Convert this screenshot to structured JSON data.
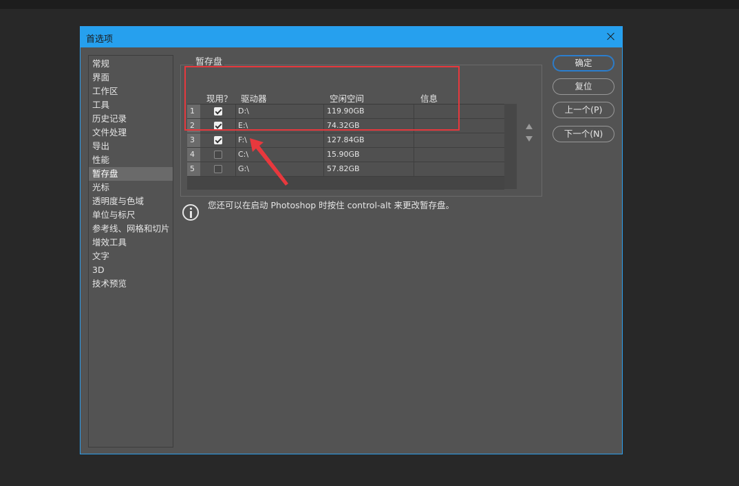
{
  "window": {
    "title": "首选项"
  },
  "sidebar": {
    "items": [
      {
        "label": "常规"
      },
      {
        "label": "界面"
      },
      {
        "label": "工作区"
      },
      {
        "label": "工具"
      },
      {
        "label": "历史记录"
      },
      {
        "label": "文件处理"
      },
      {
        "label": "导出"
      },
      {
        "label": "性能"
      },
      {
        "label": "暂存盘",
        "active": true
      },
      {
        "label": "光标"
      },
      {
        "label": "透明度与色域"
      },
      {
        "label": "单位与标尺"
      },
      {
        "label": "参考线、网格和切片"
      },
      {
        "label": "增效工具"
      },
      {
        "label": "文字"
      },
      {
        "label": "3D"
      },
      {
        "label": "技术预览"
      }
    ]
  },
  "scratch": {
    "group_label": "暂存盘",
    "columns": {
      "active": "现用？",
      "drive": "驱动器",
      "space": "空闲空间",
      "info": "信息"
    },
    "rows": [
      {
        "index": "1",
        "checked": true,
        "drive": "D:\\",
        "space": "119.90GB"
      },
      {
        "index": "2",
        "checked": true,
        "drive": "E:\\",
        "space": "74.32GB"
      },
      {
        "index": "3",
        "checked": true,
        "drive": "F:\\",
        "space": "127.84GB"
      },
      {
        "index": "4",
        "checked": false,
        "drive": "C:\\",
        "space": "15.90GB"
      },
      {
        "index": "5",
        "checked": false,
        "drive": "G:\\",
        "space": "57.82GB"
      }
    ]
  },
  "info": {
    "text": "您还可以在启动 Photoshop 时按住 control-alt 来更改暂存盘。"
  },
  "buttons": {
    "ok": "确定",
    "reset": "复位",
    "prev": "上一个(P)",
    "next": "下一个(N)"
  },
  "colors": {
    "title_bar": "#26a0ee",
    "panel": "#535353",
    "highlight": "#e8383d"
  }
}
